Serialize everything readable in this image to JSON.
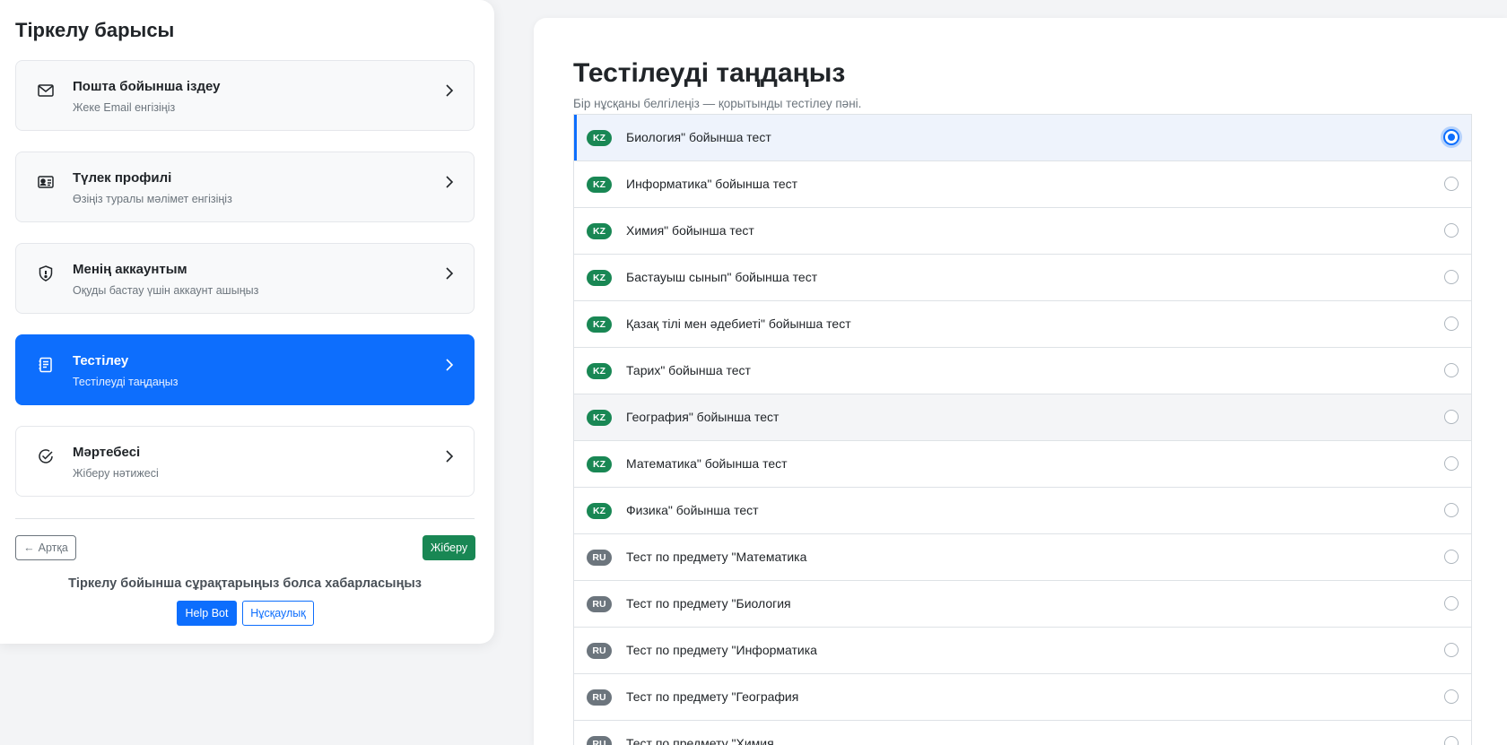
{
  "sidebar": {
    "title": "Тіркелу барысы",
    "steps": [
      {
        "label": "Пошта бойынша іздеу",
        "desc": "Жеке Email енгізіңіз",
        "icon": "envelope-icon",
        "state": "done"
      },
      {
        "label": "Түлек профилі",
        "desc": "Өзіңіз туралы мәлімет енгізіңіз",
        "icon": "id-card-icon",
        "state": "done"
      },
      {
        "label": "Менің аккаунтым",
        "desc": "Оқуды бастау үшін аккаунт ашыңыз",
        "icon": "shield-icon",
        "state": "done"
      },
      {
        "label": "Тестілеу",
        "desc": "Тестілеуді таңдаңыз",
        "icon": "document-icon",
        "state": "active"
      },
      {
        "label": "Мәртебесі",
        "desc": "Жіберу нәтижесі",
        "icon": "check-circle-icon",
        "state": "pending"
      }
    ],
    "back_label": "Артқа",
    "send_label": "Жіберу",
    "help_text": "Тіркелу бойынша сұрақтарыңыз болса хабарласыңыз",
    "helpbot_label": "Help Bot",
    "guide_label": "Нұсқаулық"
  },
  "main": {
    "title": "Тестілеуді таңдаңыз",
    "subtitle": "Бір нұсқаны белгілеңіз — қорытынды тестілеу пәні.",
    "options": [
      {
        "lang": "KZ",
        "label": "Биология\" бойынша тест",
        "selected": true
      },
      {
        "lang": "KZ",
        "label": "Информатика\" бойынша тест",
        "selected": false
      },
      {
        "lang": "KZ",
        "label": "Химия\" бойынша тест",
        "selected": false
      },
      {
        "lang": "KZ",
        "label": "Бастауыш сынып\" бойынша тест",
        "selected": false
      },
      {
        "lang": "KZ",
        "label": "Қазақ тілі мен әдебиеті\" бойынша тест",
        "selected": false
      },
      {
        "lang": "KZ",
        "label": "Тарих\" бойынша тест",
        "selected": false
      },
      {
        "lang": "KZ",
        "label": "География\" бойынша тест",
        "selected": false,
        "hovered": true
      },
      {
        "lang": "KZ",
        "label": "Математика\" бойынша тест",
        "selected": false
      },
      {
        "lang": "KZ",
        "label": "Физика\" бойынша тест",
        "selected": false
      },
      {
        "lang": "RU",
        "label": "Тест по предмету \"Математика",
        "selected": false
      },
      {
        "lang": "RU",
        "label": "Тест по предмету \"Биология",
        "selected": false
      },
      {
        "lang": "RU",
        "label": "Тест по предмету \"Информатика",
        "selected": false
      },
      {
        "lang": "RU",
        "label": "Тест по предмету \"География",
        "selected": false
      },
      {
        "lang": "RU",
        "label": "Тест по предмету \"Химия",
        "selected": false
      }
    ]
  },
  "colors": {
    "primary": "#0d6efd",
    "success": "#198754",
    "secondary": "#6c757d",
    "selected_row": "#eef3fc"
  }
}
